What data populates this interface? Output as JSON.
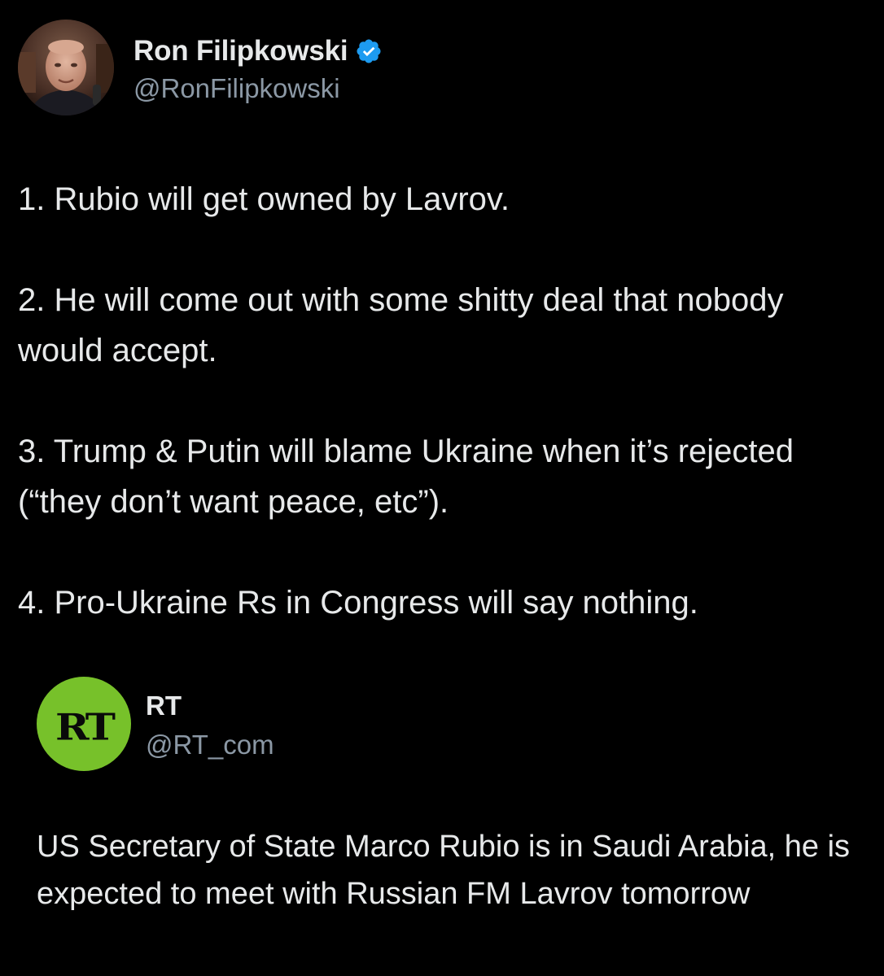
{
  "tweet": {
    "author": {
      "display_name": "Ron Filipkowski",
      "handle": "@RonFilipkowski",
      "verified_icon": "verified-badge-icon",
      "verified_color": "#1d9bf0"
    },
    "paragraphs": [
      "1. Rubio will get owned by Lavrov.",
      "2. He will come out with some shitty deal that nobody would accept.",
      "3. Trump & Putin will blame Ukraine when it’s rejected (“they don’t want peace, etc”).",
      "4. Pro-Ukraine Rs in Congress will say nothing."
    ]
  },
  "quoted_tweet": {
    "author": {
      "display_name": "RT",
      "handle": "@RT_com",
      "logo_text": "RT",
      "logo_color": "#77c12a"
    },
    "text": "US Secretary of State Marco Rubio is in Saudi Arabia, he is expected to meet with Russian FM Lavrov tomorrow"
  }
}
